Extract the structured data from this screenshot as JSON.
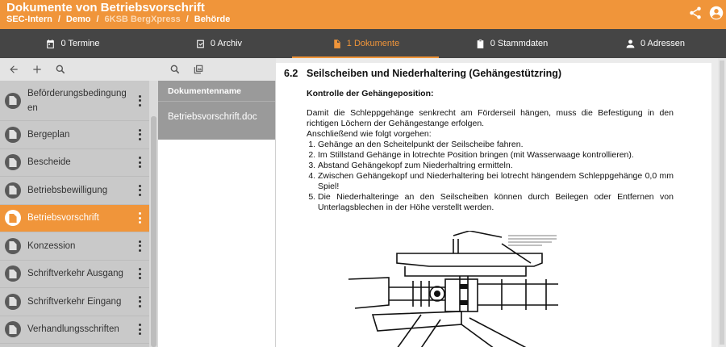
{
  "header": {
    "title": "Dokumente von Betriebsvorschrift",
    "breadcrumb": [
      "SEC-Intern",
      "Demo",
      "6KSB BergXpress",
      "Behörde"
    ],
    "icons": [
      "share-icon",
      "account-icon"
    ]
  },
  "colors": {
    "accent": "#f0953a",
    "tabbar": "#454545",
    "selected_bg": "#f0953a",
    "list_bg": "#c9c9c9",
    "table_bg": "#9a9a9a"
  },
  "tabs": [
    {
      "label": "0 Termine",
      "icon": "calendar-icon",
      "active": false
    },
    {
      "label": "0 Archiv",
      "icon": "archive-check-icon",
      "active": false
    },
    {
      "label": "1 Dokumente",
      "icon": "document-icon",
      "active": true
    },
    {
      "label": "0 Stammdaten",
      "icon": "clipboard-icon",
      "active": false
    },
    {
      "label": "0 Adressen",
      "icon": "person-icon",
      "active": false
    }
  ],
  "left_toolbar": {
    "icons": [
      "back-arrow-icon",
      "add-icon",
      "search-icon"
    ]
  },
  "categories": [
    {
      "label": "Beförderungsbedingungen",
      "selected": false
    },
    {
      "label": "Bergeplan",
      "selected": false
    },
    {
      "label": "Bescheide",
      "selected": false
    },
    {
      "label": "Betriebsbewilligung",
      "selected": false
    },
    {
      "label": "Betriebsvorschrift",
      "selected": true
    },
    {
      "label": "Konzession",
      "selected": false
    },
    {
      "label": "Schriftverkehr Ausgang",
      "selected": false
    },
    {
      "label": "Schriftverkehr Eingang",
      "selected": false
    },
    {
      "label": "Verhandlungsschriften",
      "selected": false
    }
  ],
  "mid_toolbar": {
    "icons": [
      "search-icon",
      "gallery-icon"
    ]
  },
  "documents_table": {
    "column_header": "Dokumentenname",
    "rows": [
      "Betriebsvorschrift.doc"
    ]
  },
  "document": {
    "section_number": "6.2",
    "section_title": "Seilscheiben und Niederhaltering (Gehängestützring)",
    "subheading": "Kontrolle der Gehängeposition:",
    "intro": "Damit die Schleppgehänge senkrecht am Förderseil hängen, muss die Befestigung in den richtigen Löchern der Gehängestange erfolgen.",
    "lead": "Anschließend wie folgt vorgehen:",
    "steps": [
      "Gehänge an den Scheitelpunkt der Seilscheibe fahren.",
      "Im Stillstand Gehänge in lotrechte Position bringen (mit Wasserwaage kontrollieren).",
      "Abstand Gehängekopf zum Niederhaltring ermitteln.",
      "Zwischen Gehängekopf und Niederhaltering bei lotrecht hängendem Schleppgehänge 0,0 mm Spiel!",
      "Die Niederhalteringe an den Seilscheiben können durch Beilegen oder Entfernen von Unterlagsblechen in der Höhe verstellt werden."
    ]
  }
}
